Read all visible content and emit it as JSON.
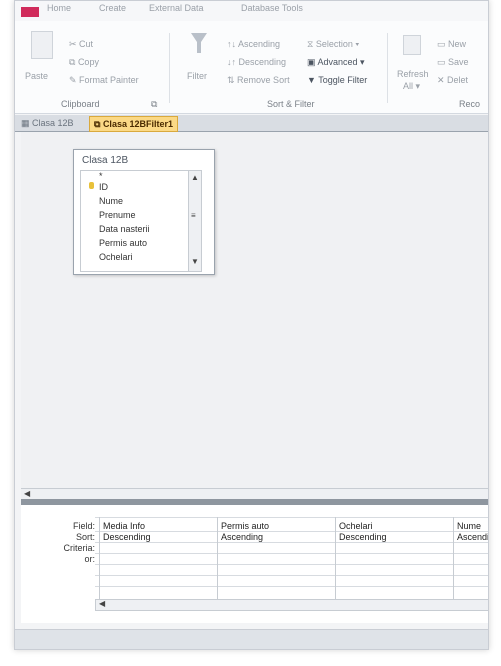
{
  "menu": {
    "tabs": [
      "Home",
      "Create",
      "External Data",
      "Database Tools"
    ]
  },
  "ribbon": {
    "clipboard": {
      "paste": "Paste",
      "cut": "Cut",
      "copy": "Copy",
      "format_painter": "Format Painter",
      "label": "Clipboard",
      "launcher": "⧉"
    },
    "sort_filter": {
      "filter": "Filter",
      "ascending": "Ascending",
      "descending": "Descending",
      "remove_sort": "Remove Sort",
      "selection": "Selection ▾",
      "advanced": "Advanced ▾",
      "toggle_filter": "Toggle Filter",
      "label": "Sort & Filter"
    },
    "records": {
      "refresh": "Refresh",
      "refresh_sub": "All ▾",
      "new": "New",
      "save": "Save",
      "delete": "Delet",
      "label": "Reco"
    }
  },
  "doc_tabs": [
    {
      "label": "Clasa 12B",
      "active": false
    },
    {
      "label": "Clasa 12BFilter1",
      "active": true
    }
  ],
  "table": {
    "name": "Clasa 12B",
    "fields": [
      "*",
      "ID",
      "Nume",
      "Prenume",
      "Data nasterii",
      "Permis auto",
      "Ochelari"
    ]
  },
  "grid": {
    "row_labels": [
      "Field:",
      "Sort:",
      "Criteria:",
      "or:"
    ],
    "columns": [
      {
        "field": "Media Info",
        "sort": "Descending"
      },
      {
        "field": "Permis auto",
        "sort": "Ascending"
      },
      {
        "field": "Ochelari",
        "sort": "Descending"
      },
      {
        "field": "Nume",
        "sort": "Ascendin"
      }
    ]
  },
  "scroll": {
    "left_arrow": "◀",
    "up_arrow": "▲",
    "down_arrow": "▼",
    "mid": "≡"
  },
  "colors": {
    "active_tab": "#fbd986",
    "brand": "#d02b5b"
  }
}
